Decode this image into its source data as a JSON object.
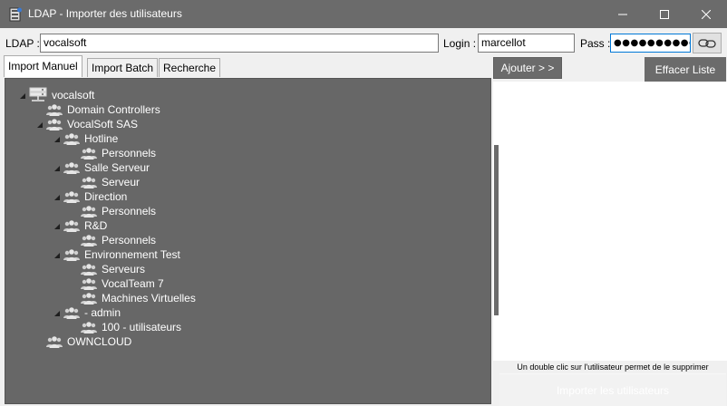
{
  "window": {
    "title": "LDAP - Importer des utilisateurs",
    "icon": "ldap-app-icon"
  },
  "credentials": {
    "ldap_label": "LDAP :",
    "ldap_value": "vocalsoft",
    "login_label": "Login :",
    "login_value": "marcellot",
    "pass_label": "Pass :",
    "pass_value": "●●●●●●●●●●●"
  },
  "tabs": [
    {
      "label": "Import Manuel",
      "active": true
    },
    {
      "label": "Import Batch",
      "active": false
    },
    {
      "label": "Recherche",
      "active": false
    }
  ],
  "tree": [
    {
      "label": "vocalsoft",
      "icon": "server-icon",
      "expanded": true
    },
    {
      "label": "Domain Controllers",
      "icon": "group-icon",
      "expanded": false
    },
    {
      "label": "VocalSoft SAS",
      "icon": "group-icon",
      "expanded": true
    },
    {
      "label": "Hotline",
      "icon": "group-icon",
      "expanded": true
    },
    {
      "label": "Personnels",
      "icon": "group-icon",
      "expanded": false
    },
    {
      "label": "Salle Serveur",
      "icon": "group-icon",
      "expanded": true
    },
    {
      "label": "Serveur",
      "icon": "group-icon",
      "expanded": false
    },
    {
      "label": "Direction",
      "icon": "group-icon",
      "expanded": true
    },
    {
      "label": "Personnels",
      "icon": "group-icon",
      "expanded": false
    },
    {
      "label": "R&D",
      "icon": "group-icon",
      "expanded": true
    },
    {
      "label": "Personnels",
      "icon": "group-icon",
      "expanded": false
    },
    {
      "label": "Environnement Test",
      "icon": "group-icon",
      "expanded": true
    },
    {
      "label": "Serveurs",
      "icon": "group-icon",
      "expanded": false
    },
    {
      "label": "VocalTeam 7",
      "icon": "group-icon",
      "expanded": false
    },
    {
      "label": "Machines Virtuelles",
      "icon": "group-icon",
      "expanded": false
    },
    {
      "label": "- admin",
      "icon": "group-icon",
      "expanded": true
    },
    {
      "label": "100 - utilisateurs",
      "icon": "group-icon",
      "expanded": false
    },
    {
      "label": "OWNCLOUD",
      "icon": "group-icon",
      "expanded": false
    }
  ],
  "actions": {
    "add_label": "Ajouter > >",
    "clear_label": "Effacer Liste",
    "hint": "Un double clic sur l'utilisateur permet de le supprimer",
    "import_label": "Importer les utilisateurs"
  }
}
